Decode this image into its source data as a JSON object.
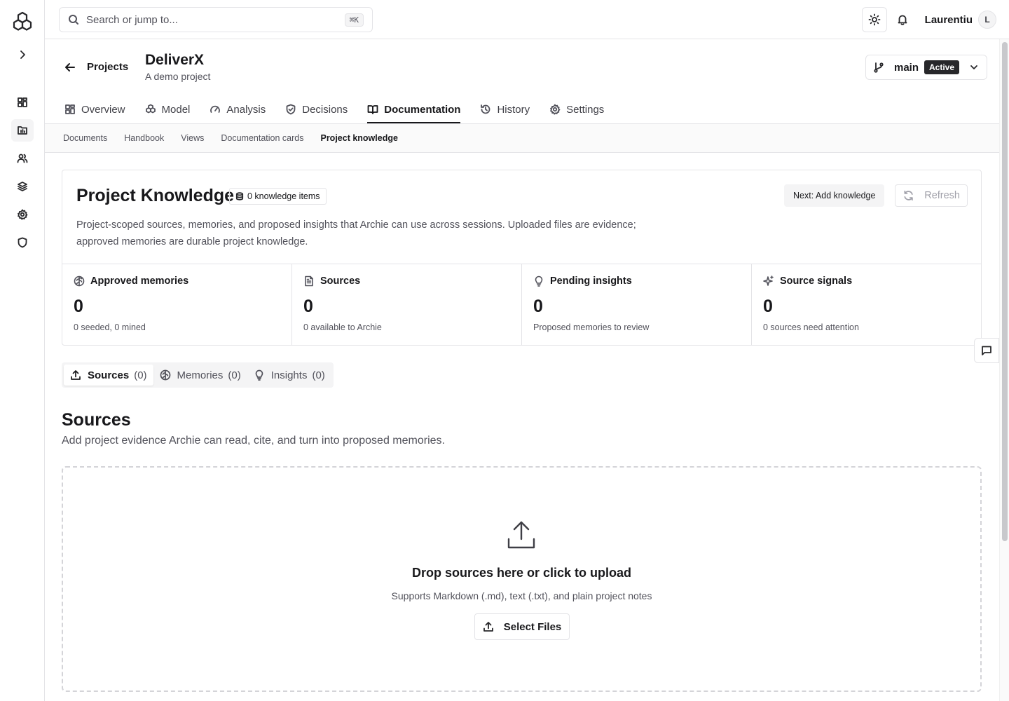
{
  "search": {
    "placeholder": "Search or jump to...",
    "shortcut": "⌘K"
  },
  "user": {
    "name": "Laurentiu",
    "initial": "L"
  },
  "header": {
    "back_label": "Projects",
    "title": "DeliverX",
    "subtitle": "A demo project",
    "branch": {
      "name": "main",
      "status": "Active"
    }
  },
  "tabs": [
    {
      "label": "Overview",
      "icon": "dashboard-icon"
    },
    {
      "label": "Model",
      "icon": "boxes-icon"
    },
    {
      "label": "Analysis",
      "icon": "gauge-icon"
    },
    {
      "label": "Decisions",
      "icon": "shield-check-icon"
    },
    {
      "label": "Documentation",
      "icon": "book-open-icon",
      "active": true
    },
    {
      "label": "History",
      "icon": "history-icon"
    },
    {
      "label": "Settings",
      "icon": "gear-icon"
    }
  ],
  "subtabs": [
    {
      "label": "Documents"
    },
    {
      "label": "Handbook"
    },
    {
      "label": "Views"
    },
    {
      "label": "Documentation cards"
    },
    {
      "label": "Project knowledge",
      "active": true
    }
  ],
  "knowledge": {
    "title": "Project Knowledge",
    "count_badge": "0 knowledge items",
    "description": "Project-scoped sources, memories, and proposed insights that Archie can use across sessions. Uploaded files are evidence; approved memories are durable project knowledge.",
    "next_button": "Next: Add knowledge",
    "refresh_button": "Refresh",
    "stats": [
      {
        "label": "Approved memories",
        "value": "0",
        "sub": "0 seeded, 0 mined",
        "icon": "brain-icon"
      },
      {
        "label": "Sources",
        "value": "0",
        "sub": "0 available to Archie",
        "icon": "file-text-icon"
      },
      {
        "label": "Pending insights",
        "value": "0",
        "sub": "Proposed memories to review",
        "icon": "lightbulb-icon"
      },
      {
        "label": "Source signals",
        "value": "0",
        "sub": "0 sources need attention",
        "icon": "sparkles-icon"
      }
    ]
  },
  "section_tabs": [
    {
      "label": "Sources",
      "count": "(0)",
      "icon": "upload-icon",
      "active": true
    },
    {
      "label": "Memories",
      "count": "(0)",
      "icon": "brain-icon"
    },
    {
      "label": "Insights",
      "count": "(0)",
      "icon": "lightbulb-icon"
    }
  ],
  "sources": {
    "title": "Sources",
    "description": "Add project evidence Archie can read, cite, and turn into proposed memories.",
    "drop_title": "Drop sources here or click to upload",
    "drop_sub": "Supports Markdown (.md), text (.txt), and plain project notes",
    "select_button": "Select Files"
  }
}
